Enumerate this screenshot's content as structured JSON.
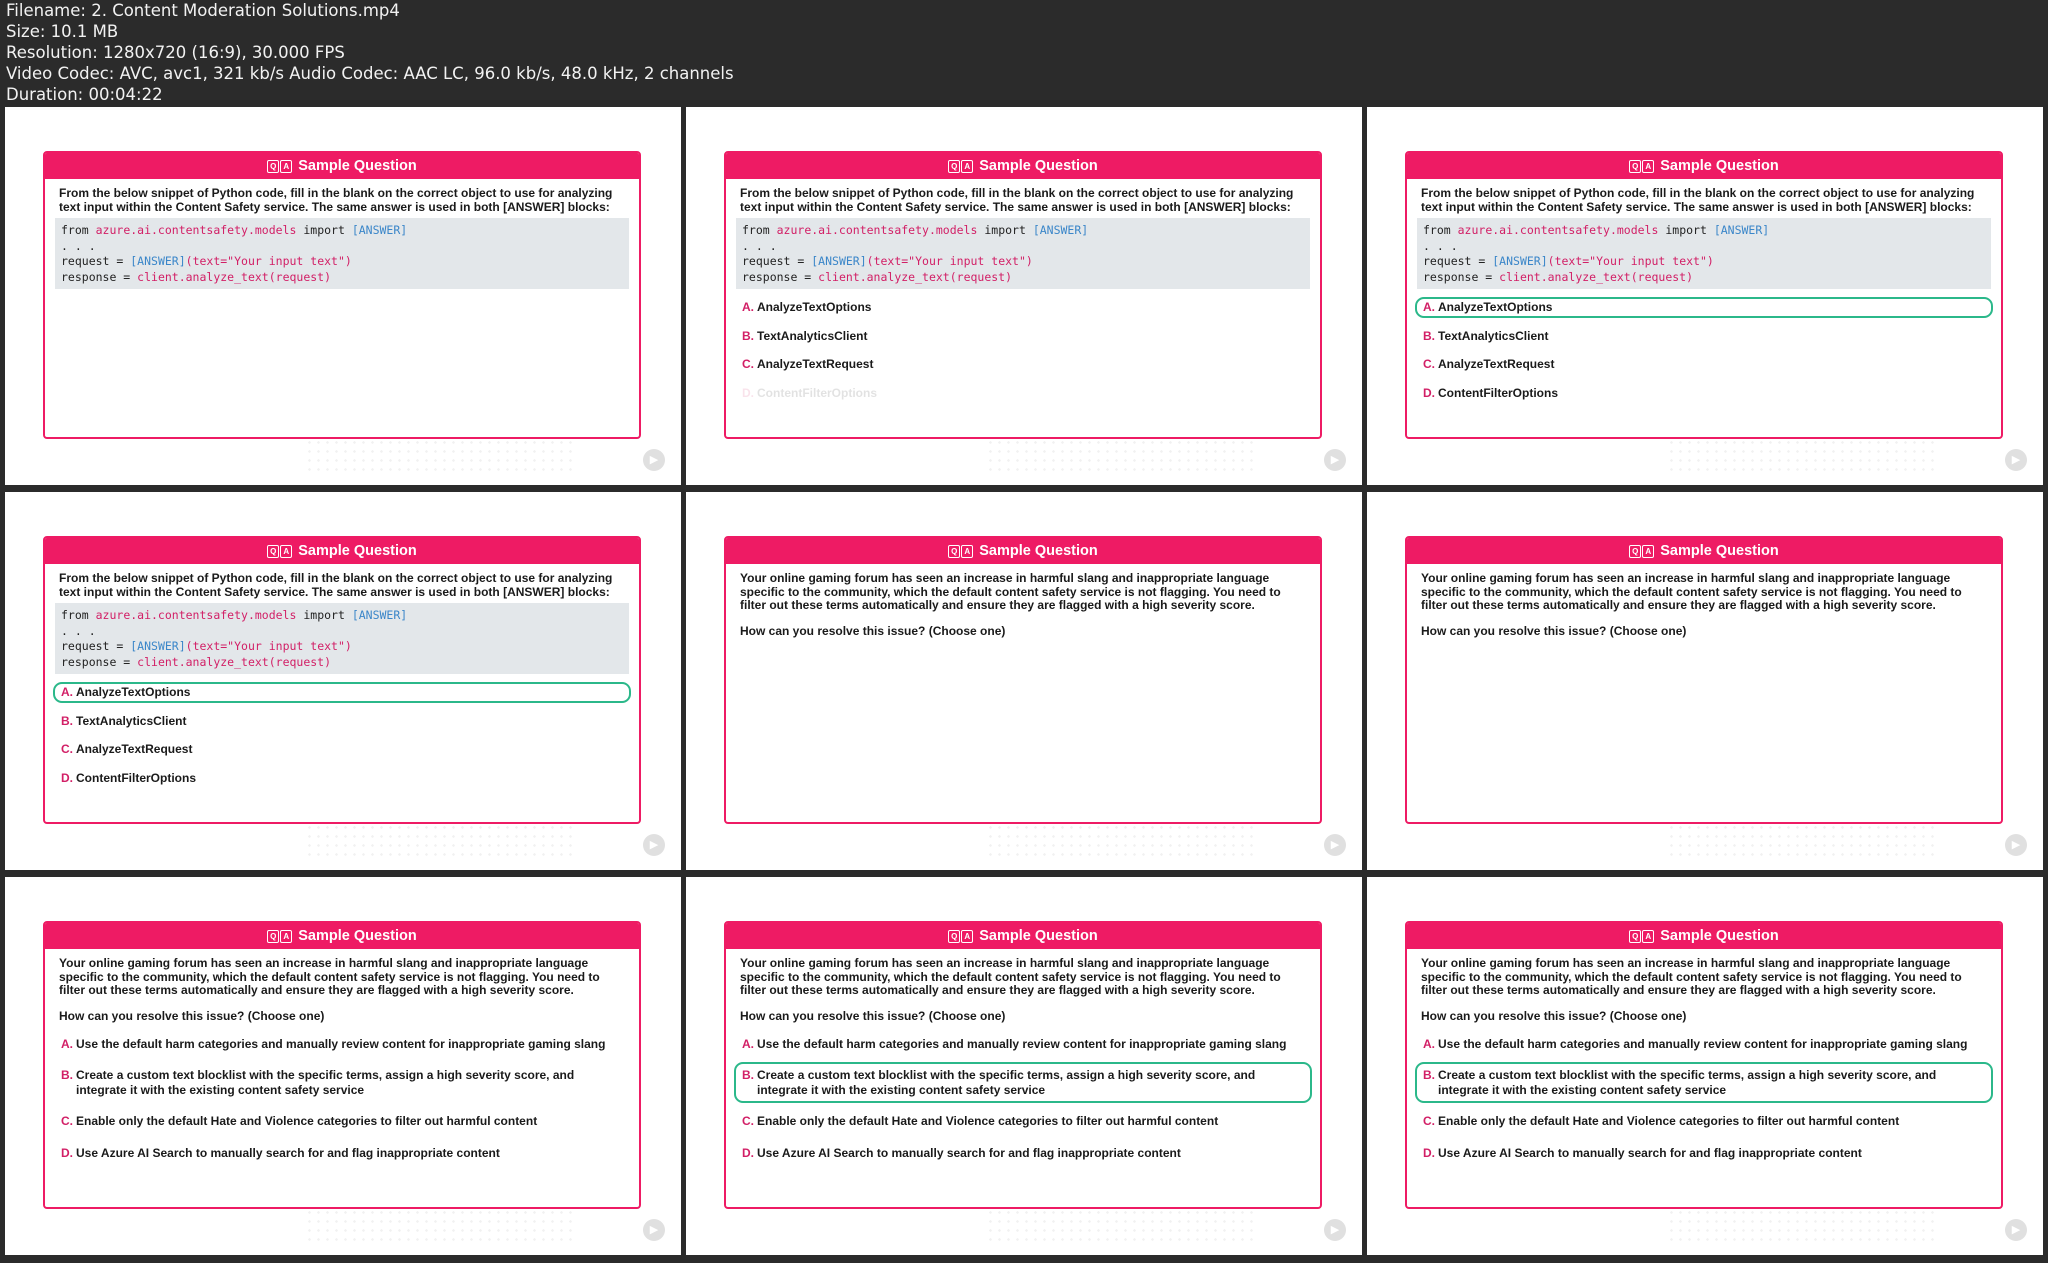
{
  "meta": {
    "filename_line": "Filename: 2. Content Moderation Solutions.mp4",
    "size_line": "Size: 10.1 MB",
    "resolution_line": "Resolution: 1280x720 (16:9), 30.000 FPS",
    "codec_line": "Video Codec: AVC, avc1, 321 kb/s Audio Codec: AAC LC, 96.0 kb/s, 48.0 kHz, 2 channels",
    "duration_line": "Duration: 00:04:22"
  },
  "header_title": "Sample Question",
  "icons": {
    "qa": "qa-icon",
    "watermark": "play-logo-icon"
  },
  "colors": {
    "accent": "#ee1b64",
    "selected": "#2bb88a",
    "code_bg": "#e3e7ea"
  },
  "q1": {
    "text": "From the below snippet of Python code, fill in the blank on the correct object to use for analyzing text input within the Content Safety service. The same answer is used in both [ANSWER] blocks:",
    "code": {
      "from_kw": "from ",
      "module": "azure.ai.contentsafety.models",
      "import_kw": " import ",
      "answer": "[ANSWER]",
      "dots": ". . .",
      "request_kw": "request = ",
      "request_rest": "(text=\"Your input text\")",
      "response_kw": "response = ",
      "response_call": "client.analyze_text(request)"
    },
    "options": [
      {
        "letter": "A.",
        "text": "AnalyzeTextOptions"
      },
      {
        "letter": "B.",
        "text": "TextAnalyticsClient"
      },
      {
        "letter": "C.",
        "text": "AnalyzeTextRequest"
      },
      {
        "letter": "D.",
        "text": "ContentFilterOptions"
      }
    ]
  },
  "q2": {
    "text": "Your online gaming forum has seen an increase in harmful slang and inappropriate language specific to the community, which the default content safety service is not flagging. You need to filter out these terms automatically and ensure they are flagged with a high severity score.",
    "prompt": "How can you resolve this issue? (Choose one)",
    "options": [
      {
        "letter": "A.",
        "text": "Use the default harm categories and manually review content for inappropriate gaming slang"
      },
      {
        "letter": "B.",
        "text": "Create a custom text blocklist with the specific terms, assign a high severity score, and integrate it with the existing content safety service"
      },
      {
        "letter": "C.",
        "text": "Enable only the default Hate and Violence categories to filter out harmful content"
      },
      {
        "letter": "D.",
        "text": "Use Azure AI Search to manually search for and flag inappropriate content"
      }
    ]
  },
  "frames": [
    {
      "question": "q1",
      "options_shown": 0,
      "faded_index": -1,
      "selected": -1
    },
    {
      "question": "q1",
      "options_shown": 4,
      "faded_index": 3,
      "selected": -1
    },
    {
      "question": "q1",
      "options_shown": 4,
      "faded_index": -1,
      "selected": 0
    },
    {
      "question": "q1",
      "options_shown": 4,
      "faded_index": -1,
      "selected": 0
    },
    {
      "question": "q2",
      "options_shown": 0,
      "faded_index": -1,
      "selected": -1
    },
    {
      "question": "q2",
      "options_shown": 0,
      "faded_index": -1,
      "selected": -1
    },
    {
      "question": "q2",
      "options_shown": 4,
      "faded_index": -1,
      "selected": -1
    },
    {
      "question": "q2",
      "options_shown": 4,
      "faded_index": -1,
      "selected": 1
    },
    {
      "question": "q2",
      "options_shown": 4,
      "faded_index": -1,
      "selected": 1
    }
  ]
}
